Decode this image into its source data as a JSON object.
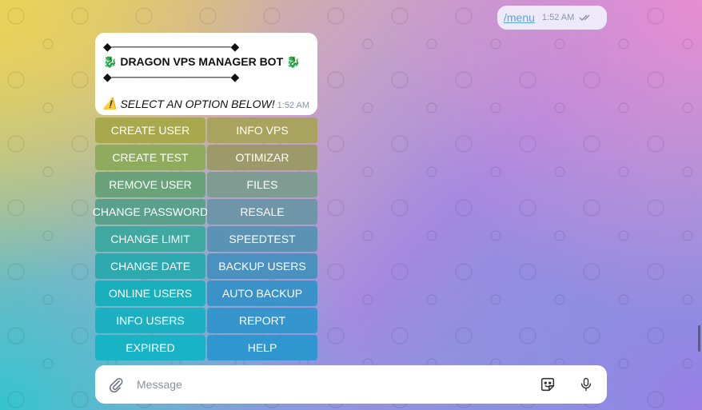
{
  "outgoing": {
    "text": "/menu",
    "time": "1:52 AM"
  },
  "bot_message": {
    "top_line": "◆───────────────◆",
    "title": "DRAGON VPS MANAGER BOT",
    "bottom_line": "◆───────────────◆",
    "prompt": "SELECT AN OPTION BELOW!",
    "time": "1:52 AM",
    "dragon_emoji": "🐉",
    "warning_emoji": "⚠️"
  },
  "keyboard": {
    "rows": [
      [
        "CREATE USER",
        "INFO VPS"
      ],
      [
        "CREATE TEST",
        "OTIMIZAR"
      ],
      [
        "REMOVE USER",
        "FILES"
      ],
      [
        "CHANGE PASSWORD",
        "RESALE"
      ],
      [
        "CHANGE LIMIT",
        "SPEEDTEST"
      ],
      [
        "CHANGE DATE",
        "BACKUP USERS"
      ],
      [
        "ONLINE USERS",
        "AUTO BACKUP"
      ],
      [
        "INFO USERS",
        "REPORT"
      ],
      [
        "EXPIRED",
        "HELP"
      ]
    ]
  },
  "composer": {
    "placeholder": "Message"
  },
  "icons": {
    "attach": "paperclip-icon",
    "sticker": "sticker-icon",
    "voice": "microphone-icon",
    "read": "double-check-icon"
  }
}
